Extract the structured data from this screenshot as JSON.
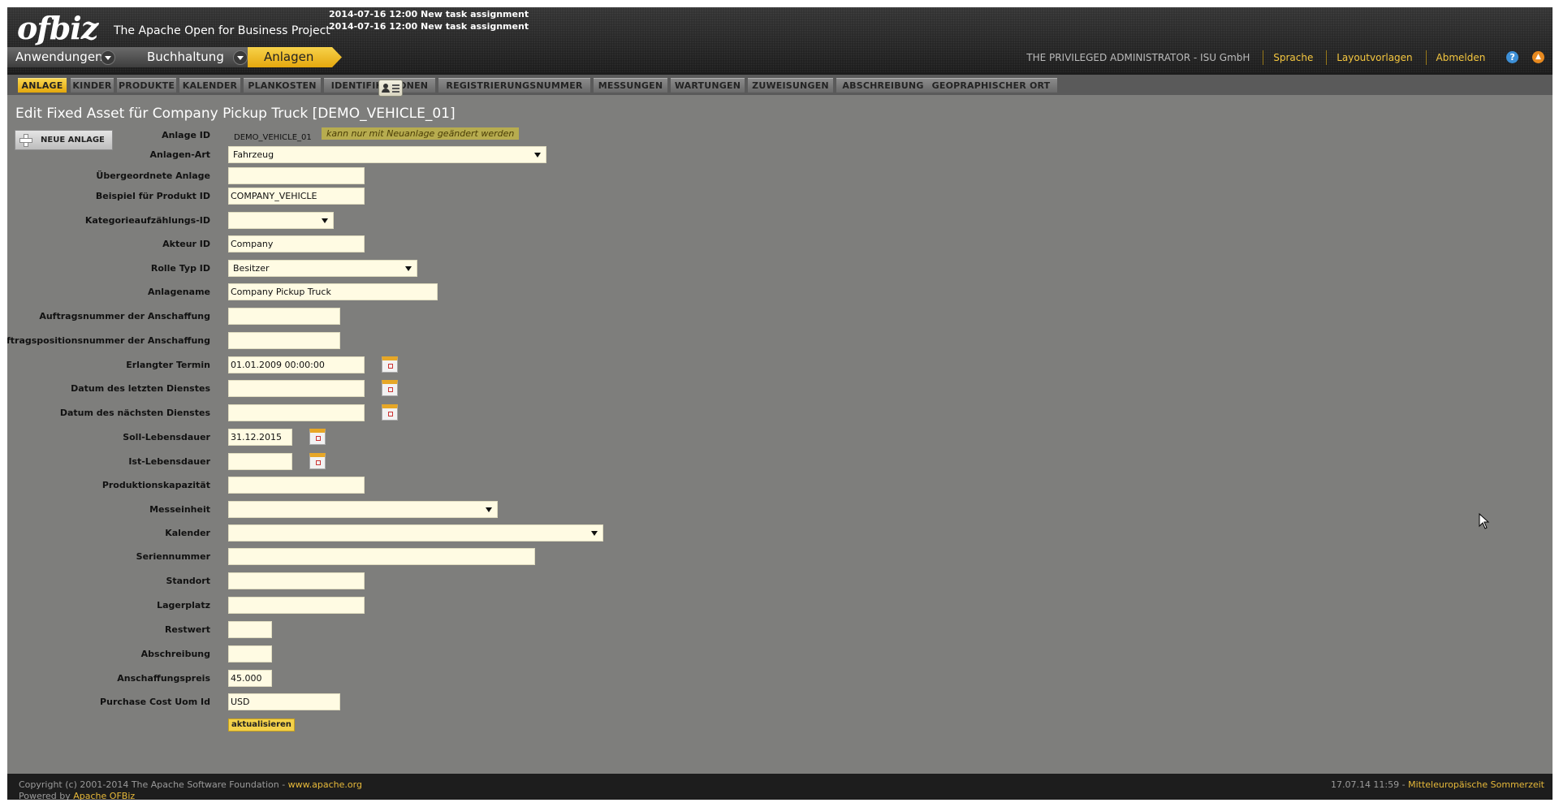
{
  "header": {
    "logo": "ofbiz",
    "tagline": "The Apache Open for Business Project",
    "alerts": [
      "2014-07-16 12:00 New task assignment",
      "2014-07-16 12:00 New task assignment"
    ],
    "app_tabs": [
      "Anwendungen",
      "Buchhaltung",
      "Anlagen"
    ],
    "user": "THE PRIVILEGED ADMINISTRATOR - ISU GmbH",
    "links": [
      "Sprache",
      "Layoutvorlagen",
      "Abmelden"
    ],
    "help_icon": "?",
    "up_icon": "▲"
  },
  "subnav": {
    "tabs": [
      "ANLAGE",
      "KINDER",
      "PRODUKTE",
      "KALENDER",
      "PLANKOSTEN",
      "IDENTIFIKATIONEN",
      "REGISTRIERUNGSNUMMER",
      "MESSUNGEN",
      "WARTUNGEN",
      "ZUWEISUNGEN",
      "ABSCHREIBUNG",
      "GEOPRAPHISCHER ORT"
    ],
    "active": "ANLAGE"
  },
  "page": {
    "title": "Edit Fixed Asset für Company Pickup Truck [DEMO_VEHICLE_01]",
    "new_button": "NEUE ANLAGE"
  },
  "form": {
    "anlage_id": {
      "label": "Anlage ID",
      "value": "DEMO_VEHICLE_01",
      "hint": "kann nur mit Neuanlage geändert werden"
    },
    "anlagen_art": {
      "label": "Anlagen-Art",
      "value": "Fahrzeug"
    },
    "uebergeordnete_anlage": {
      "label": "Übergeordnete Anlage",
      "value": ""
    },
    "beispiel_produkt_id": {
      "label": "Beispiel für Produkt ID",
      "value": "COMPANY_VEHICLE"
    },
    "kategorie_id": {
      "label": "Kategorieaufzählungs-ID",
      "value": ""
    },
    "akteur_id": {
      "label": "Akteur ID",
      "value": "Company"
    },
    "rolle_typ_id": {
      "label": "Rolle Typ ID",
      "value": "Besitzer"
    },
    "anlagename": {
      "label": "Anlagename",
      "value": "Company Pickup Truck"
    },
    "auftragsnummer": {
      "label": "Auftragsnummer der Anschaffung",
      "value": ""
    },
    "auftragsposition": {
      "label": "Auftragspositionsnummer der Anschaffung",
      "value": ""
    },
    "erlangter_termin": {
      "label": "Erlangter Termin",
      "value": "01.01.2009 00:00:00"
    },
    "letzter_dienst": {
      "label": "Datum des letzten Dienstes",
      "value": ""
    },
    "naechster_dienst": {
      "label": "Datum des nächsten Dienstes",
      "value": ""
    },
    "soll_lebensdauer": {
      "label": "Soll-Lebensdauer",
      "value": "31.12.2015"
    },
    "ist_lebensdauer": {
      "label": "Ist-Lebensdauer",
      "value": ""
    },
    "produktionskapazitaet": {
      "label": "Produktionskapazität",
      "value": ""
    },
    "messeinheit": {
      "label": "Messeinheit",
      "value": ""
    },
    "kalender": {
      "label": "Kalender",
      "value": ""
    },
    "seriennummer": {
      "label": "Seriennummer",
      "value": ""
    },
    "standort": {
      "label": "Standort",
      "value": ""
    },
    "lagerplatz": {
      "label": "Lagerplatz",
      "value": ""
    },
    "restwert": {
      "label": "Restwert",
      "value": ""
    },
    "abschreibung": {
      "label": "Abschreibung",
      "value": ""
    },
    "anschaffungspreis": {
      "label": "Anschaffungspreis",
      "value": "45.000"
    },
    "purchase_cost_uom": {
      "label": "Purchase Cost Uom Id",
      "value": "USD"
    },
    "submit": "aktualisieren"
  },
  "footer": {
    "copyright": "Copyright (c) 2001-2014 The Apache Software Foundation - ",
    "apache_link": "www.apache.org",
    "powered_by": "Powered by ",
    "ofbiz_link": "Apache OFBiz",
    "datetime": "17.07.14 11:59 - ",
    "timezone": "Mitteleuropäische Sommerzeit"
  },
  "colors": {
    "accent": "#f3c63a",
    "background": "#7e7e7c",
    "field_background": "#fffbe3",
    "header": "#262626"
  }
}
